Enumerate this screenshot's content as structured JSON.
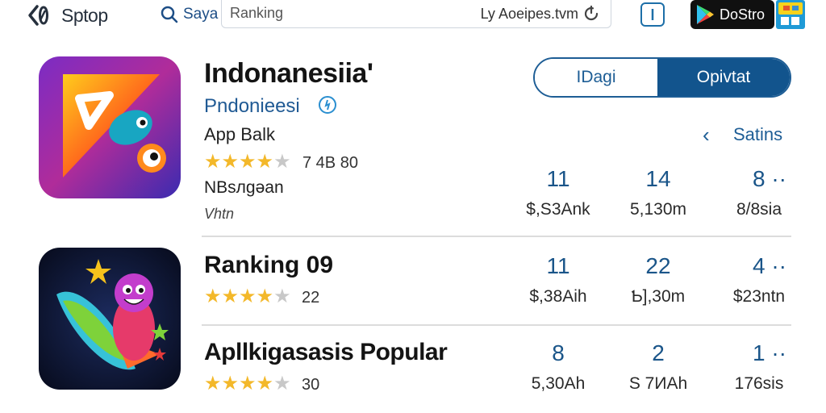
{
  "header": {
    "logo_text": "Sptop",
    "search_label": "Saya",
    "search_value": "Ranking",
    "search_hint": "Ly Aoeipes.tvm",
    "store_badge": "DoStro"
  },
  "featured": {
    "title": "Indonanesiia'",
    "developer": "Pndonieesi",
    "category": "App Balk",
    "rating_stars": 4,
    "rating_text": "7 4B 80",
    "size_text": "NBsлgəan",
    "meta": "Vhtn",
    "btn_left": "IDagi",
    "btn_right": "Opivtat",
    "sort_label": "Satins",
    "stats": [
      {
        "num": "11",
        "sub": "$,S3Ank"
      },
      {
        "num": "14",
        "sub": "5,130m"
      },
      {
        "num": "8 ··",
        "sub": "8/8sia"
      }
    ]
  },
  "rows": [
    {
      "title": "Ranking 09",
      "rating_stars": 4,
      "rating_text": "22",
      "stats": [
        {
          "num": "11",
          "sub": "$,38Aih"
        },
        {
          "num": "22",
          "sub": "Ƅ],30m"
        },
        {
          "num": "4 ··",
          "sub": "$23ntn"
        }
      ]
    },
    {
      "title": "Apllkigasasis Popular",
      "rating_stars": 4,
      "rating_text": "30",
      "stats": [
        {
          "num": "8",
          "sub": "5,30Ah"
        },
        {
          "num": "2",
          "sub": "S 7ИAh"
        },
        {
          "num": "1 ··",
          "sub": "176sis"
        }
      ]
    }
  ],
  "colors": {
    "accent": "#12548d",
    "star": "#f3b82a",
    "text_link": "#205a94"
  }
}
